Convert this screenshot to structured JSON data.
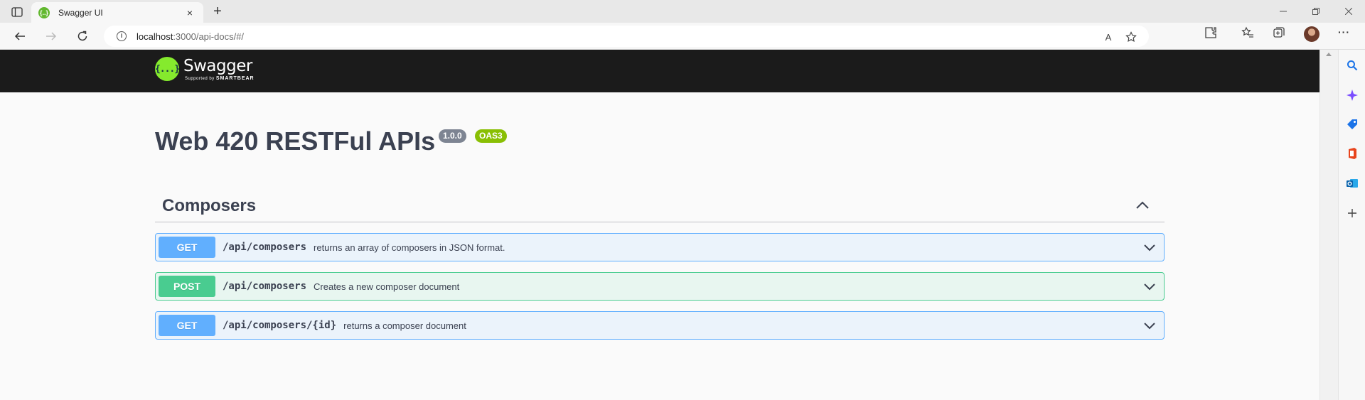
{
  "browser": {
    "tab_title": "Swagger UI",
    "tab_favicon": "{..}",
    "new_tab": "+",
    "tab_close": "×",
    "url_host": "localhost",
    "url_path": ":3000/api-docs/#/",
    "info_glyph": "i",
    "more_glyph": "···",
    "read_aloud_glyph": "A"
  },
  "swagger": {
    "logo_mark": "{...}",
    "logo_name": "Swagger",
    "logo_supported": "Supported by",
    "logo_brand": "SMARTBEAR",
    "title": "Web 420 RESTFul APIs",
    "version": "1.0.0",
    "oas": "OAS3",
    "tag": {
      "name": "Composers",
      "operations": [
        {
          "method": "GET",
          "path": "/api/composers",
          "summary": "returns an array of composers in JSON format."
        },
        {
          "method": "POST",
          "path": "/api/composers",
          "summary": "Creates a new composer document"
        },
        {
          "method": "GET",
          "path": "/api/composers/{id}",
          "summary": "returns a composer document"
        }
      ]
    }
  },
  "colors": {
    "topbar": "#1b1b1b",
    "get": "#61affe",
    "post": "#49cc90",
    "swagger_green": "#85ea2d"
  }
}
